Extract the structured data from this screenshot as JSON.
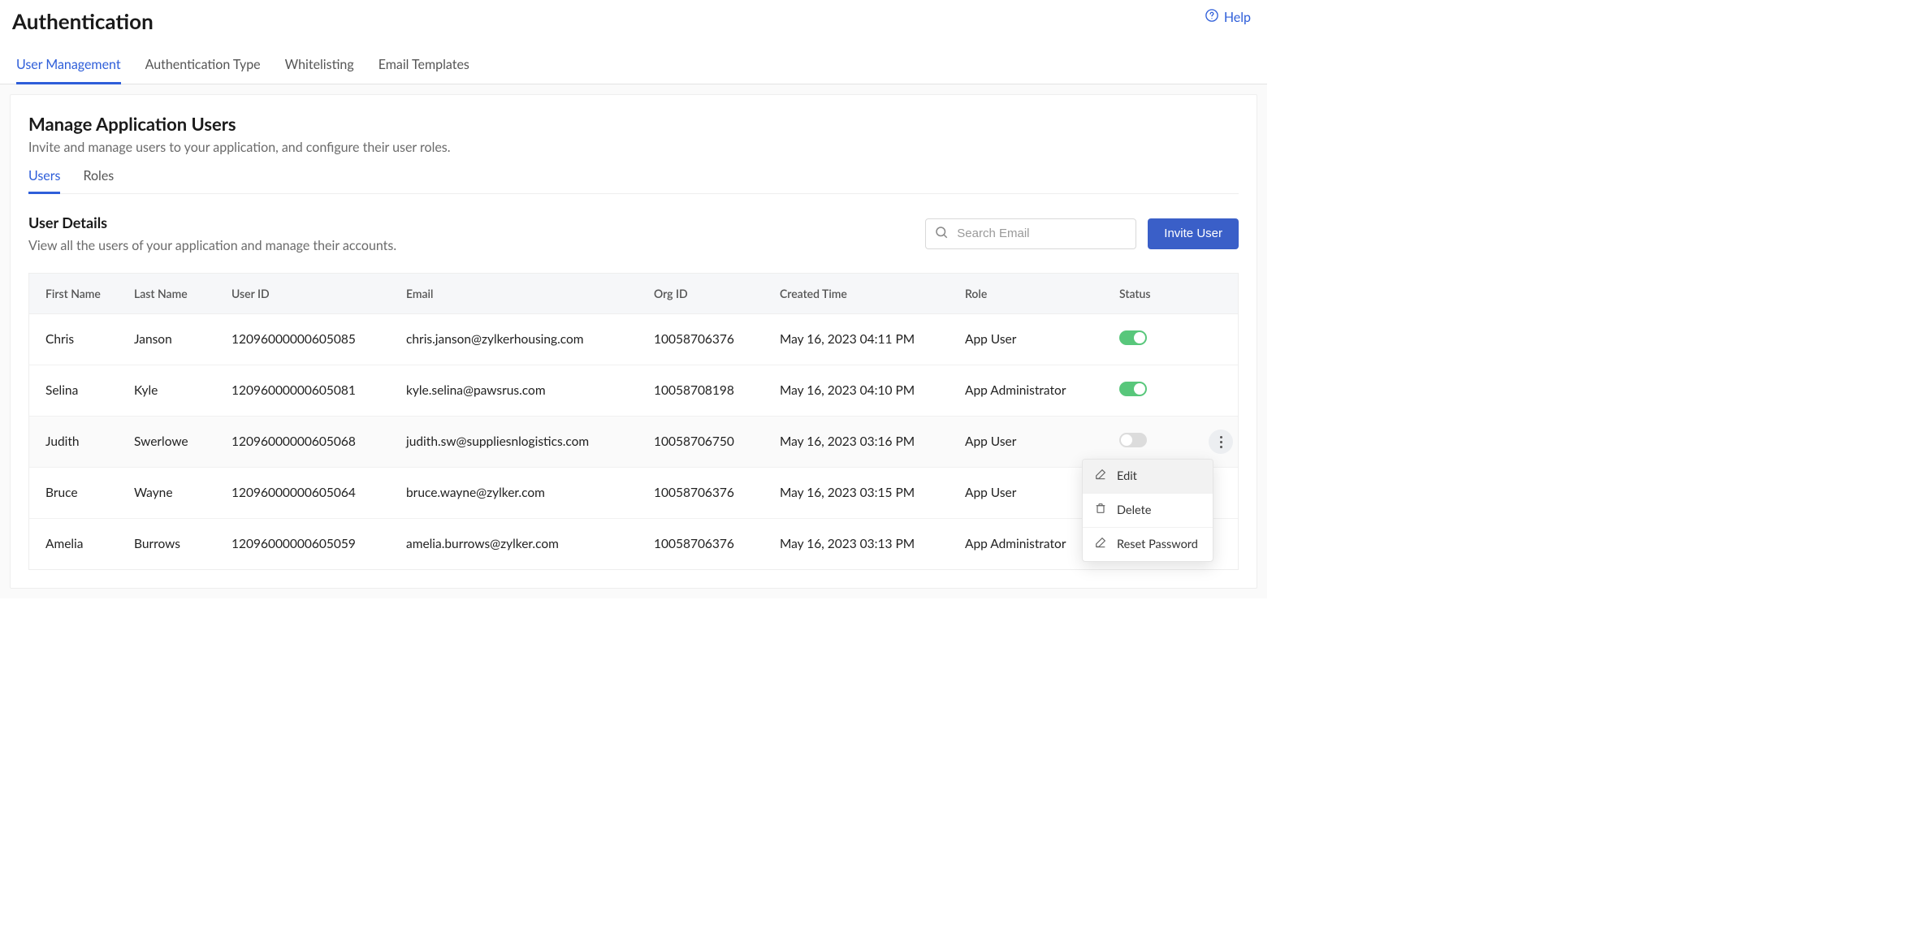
{
  "header": {
    "title": "Authentication",
    "help_label": "Help"
  },
  "top_tabs": [
    {
      "label": "User Management",
      "active": true
    },
    {
      "label": "Authentication Type",
      "active": false
    },
    {
      "label": "Whitelisting",
      "active": false
    },
    {
      "label": "Email Templates",
      "active": false
    }
  ],
  "panel": {
    "title": "Manage Application Users",
    "subtitle": "Invite and manage users to your application, and configure their user roles."
  },
  "inner_tabs": [
    {
      "label": "Users",
      "active": true
    },
    {
      "label": "Roles",
      "active": false
    }
  ],
  "section": {
    "title": "User Details",
    "subtitle": "View all the users of your application and manage their accounts."
  },
  "search": {
    "placeholder": "Search Email"
  },
  "buttons": {
    "invite": "Invite User"
  },
  "columns": [
    "First Name",
    "Last Name",
    "User ID",
    "Email",
    "Org ID",
    "Created Time",
    "Role",
    "Status"
  ],
  "rows": [
    {
      "first": "Chris",
      "last": "Janson",
      "user_id": "12096000000605085",
      "email": "chris.janson@zylkerhousing.com",
      "org_id": "10058706376",
      "created": "May 16, 2023 04:11 PM",
      "role": "App User",
      "status_on": true,
      "show_menu": false
    },
    {
      "first": "Selina",
      "last": "Kyle",
      "user_id": "12096000000605081",
      "email": "kyle.selina@pawsrus.com",
      "org_id": "10058708198",
      "created": "May 16, 2023 04:10 PM",
      "role": "App Administrator",
      "status_on": true,
      "show_menu": false
    },
    {
      "first": "Judith",
      "last": "Swerlowe",
      "user_id": "12096000000605068",
      "email": "judith.sw@suppliesnlogistics.com",
      "org_id": "10058706750",
      "created": "May 16, 2023 03:16 PM",
      "role": "App User",
      "status_on": false,
      "show_menu": true
    },
    {
      "first": "Bruce",
      "last": "Wayne",
      "user_id": "12096000000605064",
      "email": "bruce.wayne@zylker.com",
      "org_id": "10058706376",
      "created": "May 16, 2023 03:15 PM",
      "role": "App User",
      "status_on": true,
      "show_menu": false
    },
    {
      "first": "Amelia",
      "last": "Burrows",
      "user_id": "12096000000605059",
      "email": "amelia.burrows@zylker.com",
      "org_id": "10058706376",
      "created": "May 16, 2023 03:13 PM",
      "role": "App Administrator",
      "status_on": true,
      "show_menu": false
    }
  ],
  "menu": {
    "edit": "Edit",
    "delete": "Delete",
    "reset": "Reset Password"
  }
}
